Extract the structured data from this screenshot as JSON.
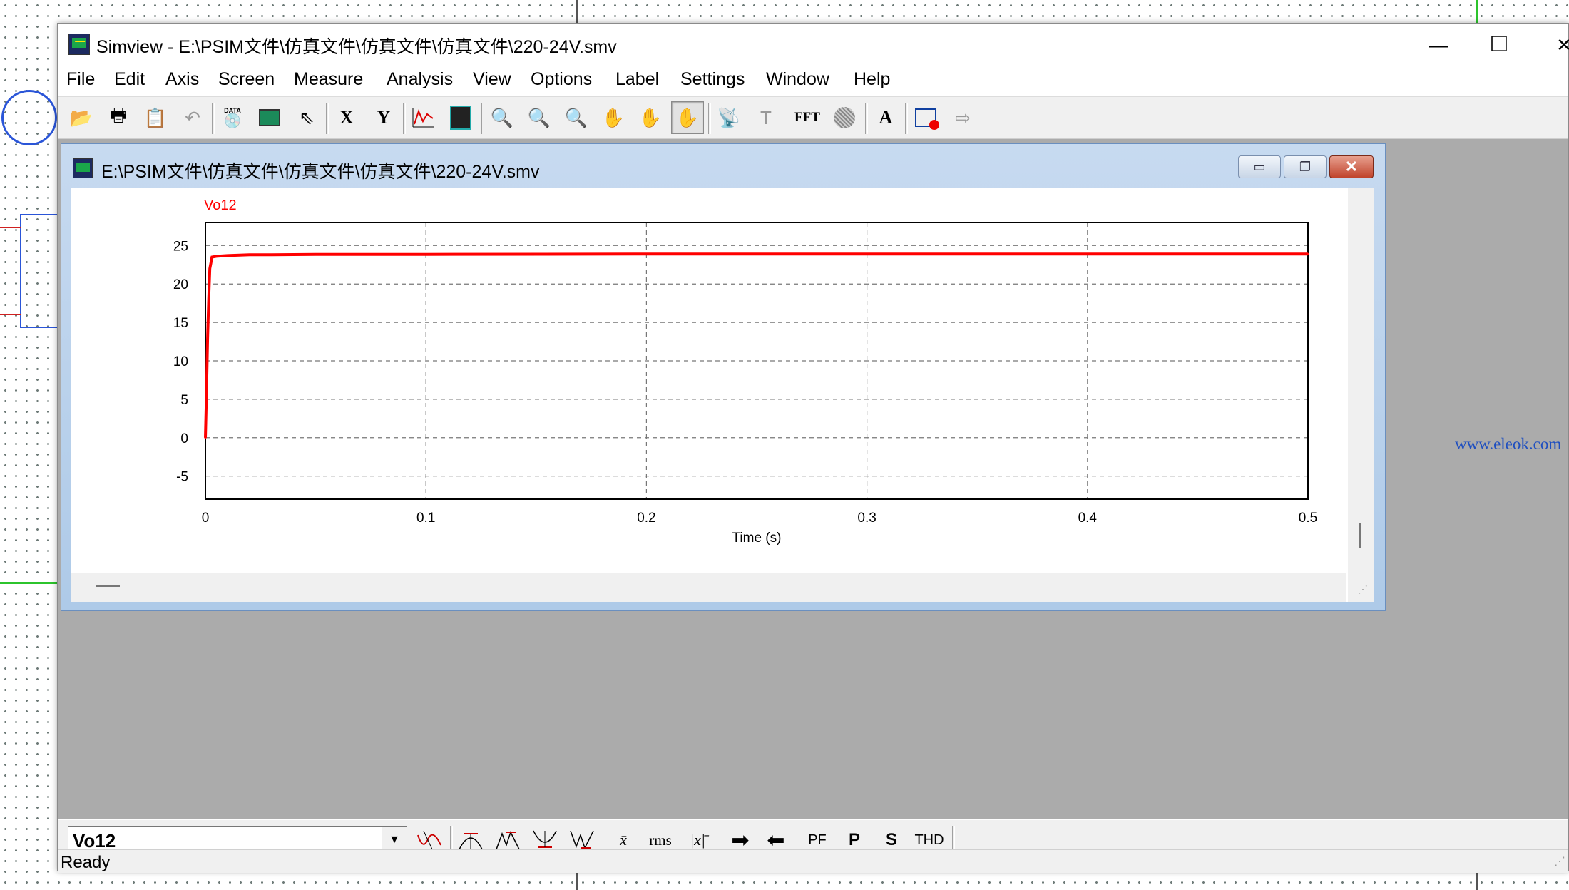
{
  "window": {
    "title": "Simview - E:\\PSIM文件\\仿真文件\\仿真文件\\仿真文件\\220-24V.smv",
    "min_symbol": "—",
    "max_symbol": "☐",
    "close_symbol": "✕"
  },
  "menu": [
    "File",
    "Edit",
    "Axis",
    "Screen",
    "Measure",
    "Analysis",
    "View",
    "Options",
    "Label",
    "Settings",
    "Window",
    "Help"
  ],
  "toolbar": {
    "data_label": "DATA",
    "x_label": "X",
    "y_label": "Y",
    "fft_label": "FFT",
    "text_label": "A",
    "icons": [
      "open-icon",
      "print-icon",
      "clipboard-icon",
      "undo-icon",
      "data-disk-icon",
      "load-waveform-icon",
      "cursor-icon",
      "x-axis-icon",
      "y-axis-icon",
      "add-curve-icon",
      "screen-icon",
      "zoom-icon",
      "zoom-in-icon",
      "zoom-out-icon",
      "pan-icon",
      "pan-hand-icon",
      "hand-icon",
      "measure-icon",
      "text-cursor-icon",
      "fft-icon",
      "circle-icon",
      "text-icon",
      "record-icon",
      "export-icon"
    ]
  },
  "child_window": {
    "title": "E:\\PSIM文件\\仿真文件\\仿真文件\\仿真文件\\220-24V.smv"
  },
  "chart_data": {
    "type": "line",
    "legend": "Vo12",
    "xlabel": "Time (s)",
    "ylabel": "",
    "xlim": [
      0,
      0.5
    ],
    "ylim": [
      -8,
      28
    ],
    "xticks": [
      0,
      0.1,
      0.2,
      0.3,
      0.4,
      0.5
    ],
    "xtick_labels": [
      "0",
      "0.1",
      "0.2",
      "0.3",
      "0.4",
      "0.5"
    ],
    "yticks": [
      25,
      20,
      15,
      10,
      5,
      0,
      -5
    ],
    "ytick_labels": [
      "25",
      "20",
      "15",
      "10",
      "5",
      "0",
      "-5"
    ],
    "grid": true,
    "series": [
      {
        "name": "Vo12",
        "color": "#ff0000",
        "x": [
          0,
          0.0005,
          0.001,
          0.0015,
          0.002,
          0.003,
          0.005,
          0.01,
          0.02,
          0.03,
          0.05,
          0.1,
          0.2,
          0.3,
          0.4,
          0.5
        ],
        "y": [
          0,
          6,
          13,
          18,
          22,
          23.5,
          23.6,
          23.7,
          23.8,
          23.8,
          23.85,
          23.85,
          23.9,
          23.9,
          23.9,
          23.9
        ]
      }
    ]
  },
  "waveform_bar": {
    "selected_signal": "Vo12",
    "rms_label": "rms",
    "pf_label": "PF",
    "p_label": "P",
    "s_label": "S",
    "thd_label": "THD",
    "mean_label": "x̄",
    "abs_mean_label": "|x|̄"
  },
  "status": {
    "text": "Ready"
  },
  "watermark": "www.eleok.com"
}
